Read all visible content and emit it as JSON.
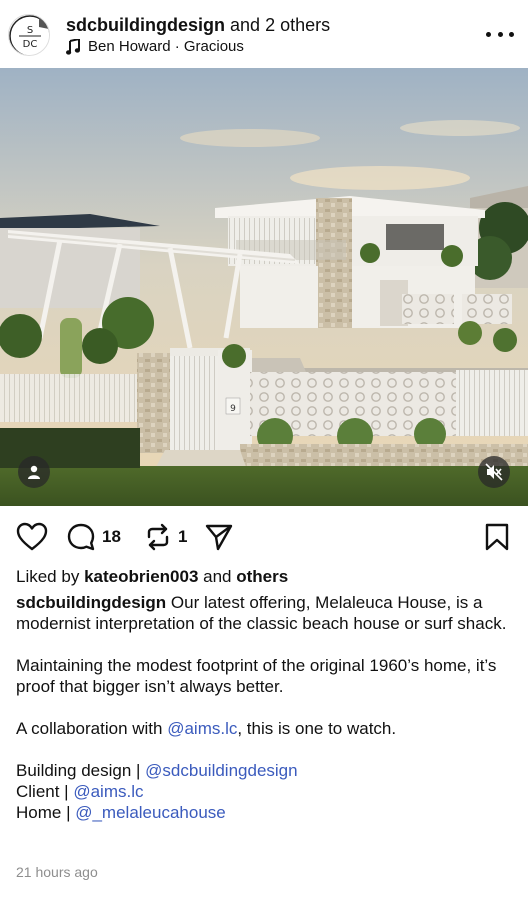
{
  "header": {
    "username": "sdcbuildingdesign",
    "others": "and 2 others",
    "avatar_text_top": "S",
    "avatar_text_bottom": "DC",
    "music_icon": "music-note-icon",
    "music": "Ben Howard · Gracious",
    "more_icon": "more-horizontal-icon"
  },
  "photo": {
    "house_number": "9",
    "tag_icon": "person-icon",
    "mute_icon": "speaker-muted-icon"
  },
  "actions": {
    "like_icon": "heart-icon",
    "comment_icon": "comment-icon",
    "comment_count": "18",
    "repost_icon": "repost-icon",
    "repost_count": "1",
    "share_icon": "send-icon",
    "save_icon": "bookmark-icon"
  },
  "liked_by": {
    "prefix": "Liked by",
    "user": "kateobrien003",
    "middle": "and",
    "others": "others"
  },
  "caption": {
    "username": "sdcbuildingdesign",
    "line1": " Our latest offering, Melaleuca House, is a modernist interpretation of the classic beach house or surf shack.",
    "para2": "Maintaining the modest footprint of the original 1960’s home, it’s proof that bigger isn’t always better.",
    "para3_prefix": "A collaboration with ",
    "para3_link": "@aims.lc",
    "para3_suffix": ", this is one to watch.",
    "credit1_label": "Building design | ",
    "credit1_link": "@sdcbuildingdesign",
    "credit2_label": "Client | ",
    "credit2_link": "@aims.lc",
    "credit3_label": "Home | ",
    "credit3_link": "@_melaleucahouse"
  },
  "timestamp": "21 hours ago",
  "colors": {
    "link": "#3b5bbd",
    "muted": "#8e8e8e",
    "text": "#111111"
  }
}
